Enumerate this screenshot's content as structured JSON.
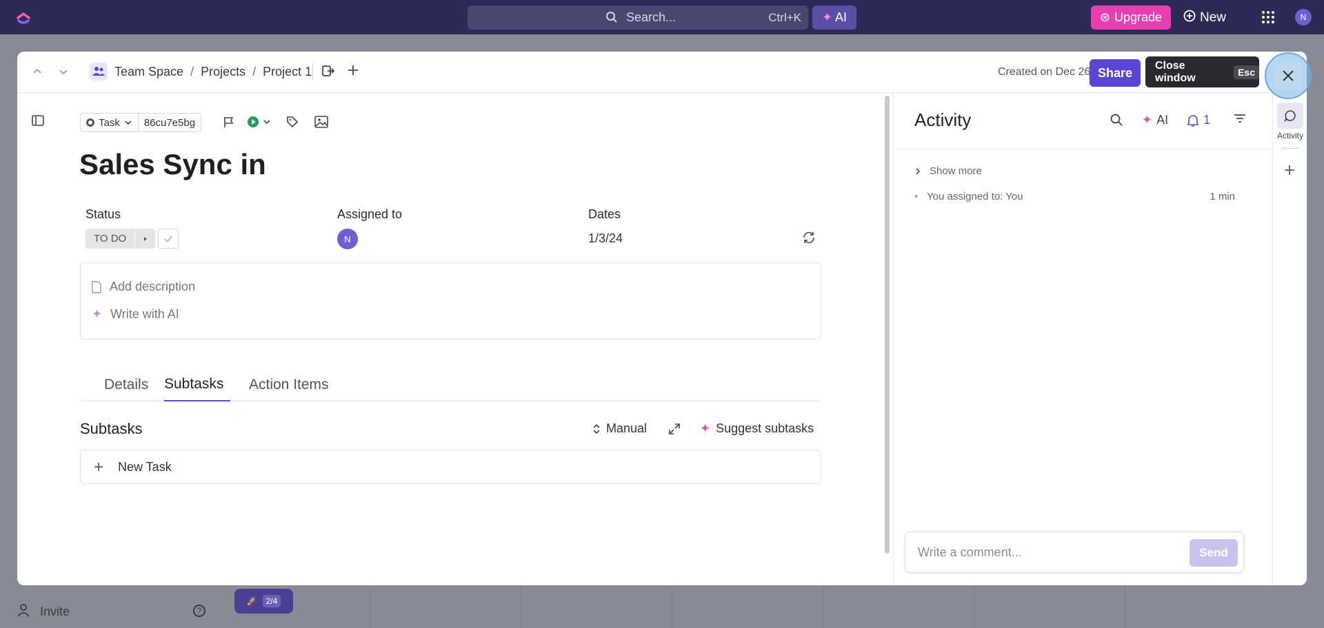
{
  "topbar": {
    "search_label": "Search...",
    "search_shortcut": "Ctrl+K",
    "ai_label": "AI",
    "upgrade_label": "Upgrade",
    "new_label": "New",
    "avatar_initial": "N"
  },
  "background": {
    "invite_label": "Invite",
    "help_label": "?",
    "progress_badge": "2/4"
  },
  "breadcrumb": {
    "space": "Team Space",
    "folder": "Projects",
    "list": "Project 1",
    "separator": "/"
  },
  "header": {
    "created": "Created on Dec 26",
    "share_label": "Share"
  },
  "tooltip": {
    "text": "Close window",
    "key": "Esc"
  },
  "task": {
    "type_label": "Task",
    "id": "86cu7e5bg",
    "title": "Sales Sync in",
    "status_label": "Status",
    "status_value": "TO DO",
    "assigned_label": "Assigned to",
    "assignee_initial": "N",
    "dates_label": "Dates",
    "dates_value": "1/3/24",
    "add_description": "Add description",
    "write_ai": "Write with AI"
  },
  "tabs": [
    {
      "label": "Details"
    },
    {
      "label": "Subtasks"
    },
    {
      "label": "Action Items"
    }
  ],
  "subtasks": {
    "heading": "Subtasks",
    "sort_label": "Manual",
    "suggest_label": "Suggest subtasks",
    "new_task_label": "New Task"
  },
  "activity": {
    "title": "Activity",
    "ai_label": "AI",
    "notif_count": "1",
    "show_more": "Show more",
    "log": [
      {
        "text": "You assigned to: You",
        "time": "1 min"
      }
    ],
    "comment_placeholder": "Write a comment...",
    "send_label": "Send"
  },
  "rail": {
    "activity_label": "Activity"
  },
  "colors": {
    "accent": "#5a46d6",
    "topbar": "#2e2a55",
    "upgrade": "#e83eb0"
  }
}
